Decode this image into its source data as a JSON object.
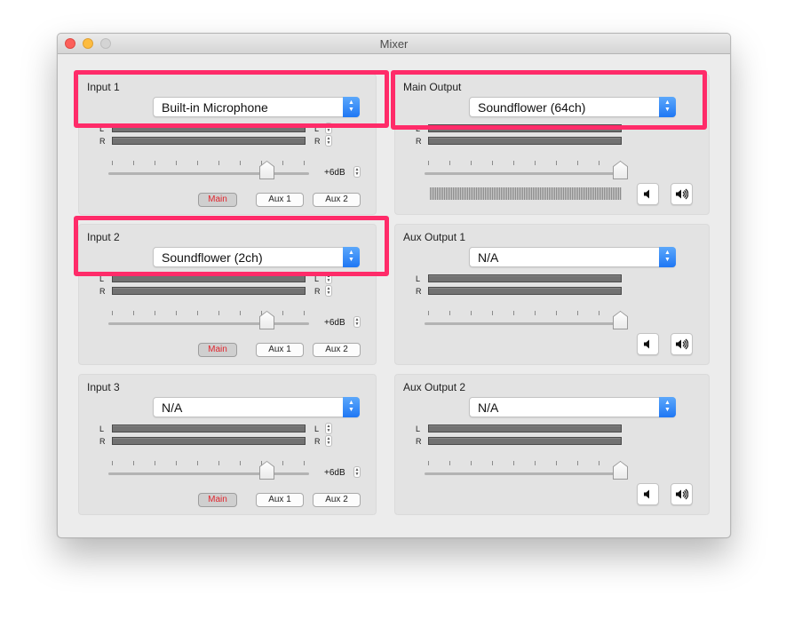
{
  "window": {
    "title": "Mixer"
  },
  "inputs": [
    {
      "label": "Input 1",
      "device": "Built-in Microphone",
      "gain": "+6dB",
      "ch_l": "L",
      "ch_r": "R",
      "buttons": [
        "Main",
        "Aux 1",
        "Aux 2"
      ],
      "active": "Main"
    },
    {
      "label": "Input 2",
      "device": "Soundflower (2ch)",
      "gain": "+6dB",
      "ch_l": "L",
      "ch_r": "R",
      "buttons": [
        "Main",
        "Aux 1",
        "Aux 2"
      ],
      "active": "Main"
    },
    {
      "label": "Input 3",
      "device": "N/A",
      "gain": "+6dB",
      "ch_l": "L",
      "ch_r": "R",
      "buttons": [
        "Main",
        "Aux 1",
        "Aux 2"
      ],
      "active": "Main"
    }
  ],
  "outputs": [
    {
      "label": "Main Output",
      "device": "Soundflower (64ch)",
      "ch_l": "L",
      "ch_r": "R"
    },
    {
      "label": "Aux Output 1",
      "device": "N/A",
      "ch_l": "L",
      "ch_r": "R"
    },
    {
      "label": "Aux Output 2",
      "device": "N/A",
      "ch_l": "L",
      "ch_r": "R"
    }
  ],
  "icons": {
    "mute": "speaker-mute-icon",
    "volume": "speaker-volume-icon",
    "select_arrows": "up-down-chevron-icon"
  },
  "colors": {
    "highlight": "#ff2b69",
    "active_button_text": "#e1262e",
    "select_accent": "#1f77f4"
  }
}
